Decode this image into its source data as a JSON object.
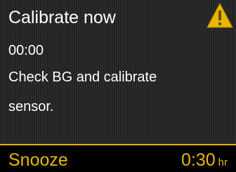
{
  "alert": {
    "title": "Calibrate now",
    "time": "00:00",
    "message_line1": "Check BG and calibrate",
    "message_line2": "sensor.",
    "icon": "warning-triangle-icon",
    "icon_color": "#e6b800"
  },
  "footer": {
    "snooze_label": "Snooze",
    "snooze_value": "0:30",
    "snooze_unit": "hr",
    "accent_color": "#e6b800"
  }
}
